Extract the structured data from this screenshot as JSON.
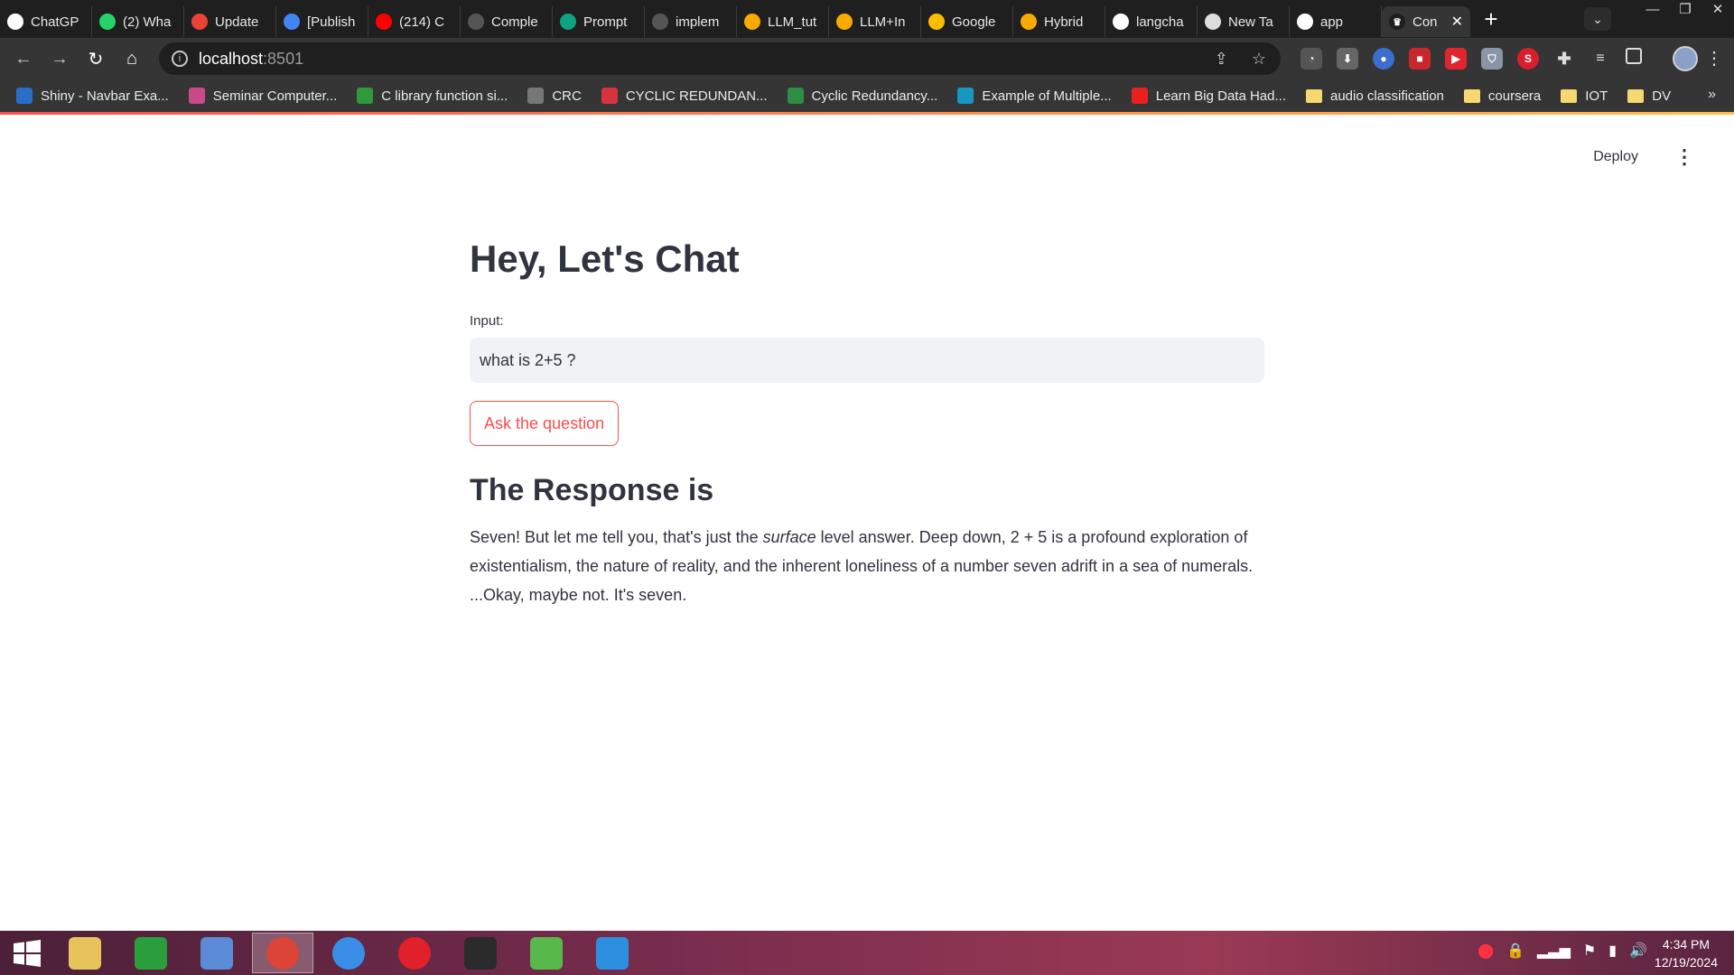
{
  "browser": {
    "tabs": [
      {
        "label": "ChatGP",
        "icon": "chatgpt-icon",
        "color": "#ffffff"
      },
      {
        "label": "(2) Wha",
        "icon": "whatsapp-icon",
        "color": "#25d366"
      },
      {
        "label": "Update",
        "icon": "gmail-icon",
        "color": "#ea4335"
      },
      {
        "label": "[Publish",
        "icon": "docs-icon",
        "color": "#4285f4"
      },
      {
        "label": "(214) C",
        "icon": "youtube-icon",
        "color": "#ff0000"
      },
      {
        "label": "Comple",
        "icon": "github-icon",
        "color": "#555555"
      },
      {
        "label": "Prompt",
        "icon": "chatgpt-icon",
        "color": "#10a37f"
      },
      {
        "label": "implem",
        "icon": "github-icon",
        "color": "#555555"
      },
      {
        "label": "LLM_tut",
        "icon": "colab-icon",
        "color": "#f9ab00"
      },
      {
        "label": "LLM+In",
        "icon": "colab-icon",
        "color": "#f9ab00"
      },
      {
        "label": "Google",
        "icon": "keep-icon",
        "color": "#fbbc04"
      },
      {
        "label": "Hybrid",
        "icon": "colab-icon",
        "color": "#f9ab00"
      },
      {
        "label": "langcha",
        "icon": "google-icon",
        "color": "#ffffff"
      },
      {
        "label": "New Ta",
        "icon": "chrome-icon",
        "color": "#dddddd"
      },
      {
        "label": "app",
        "icon": "streamlit-icon",
        "color": "#ffffff"
      }
    ],
    "active_tab": {
      "label": "Con",
      "icon": "streamlit-icon"
    },
    "address": {
      "host": "localhost",
      "port": ":8501"
    },
    "bookmarks": [
      {
        "label": "Shiny - Navbar Exa...",
        "icon": "shiny-icon",
        "color": "#2a6ec8"
      },
      {
        "label": "Seminar Computer...",
        "icon": "seminar-icon",
        "color": "#c84a8a"
      },
      {
        "label": "C library function si...",
        "icon": "c-library-icon",
        "color": "#2e9a3c"
      },
      {
        "label": "CRC",
        "icon": "globe-icon",
        "color": "#777777"
      },
      {
        "label": "CYCLIC REDUNDAN...",
        "icon": "scribd-icon",
        "color": "#d8323c"
      },
      {
        "label": "Cyclic Redundancy...",
        "icon": "gfg-icon",
        "color": "#2f8d46"
      },
      {
        "label": "Example of Multiple...",
        "icon": "salesforce-icon",
        "color": "#1798c1"
      },
      {
        "label": "Learn Big Data Had...",
        "icon": "vertex-icon",
        "color": "#e82020"
      },
      {
        "label": "audio classification",
        "icon": "folder-icon",
        "color": "#f5d870"
      },
      {
        "label": "coursera",
        "icon": "folder-icon",
        "color": "#f5d870"
      },
      {
        "label": "IOT",
        "icon": "folder-icon",
        "color": "#f5d870"
      },
      {
        "label": "DV",
        "icon": "folder-icon",
        "color": "#f5d870"
      }
    ]
  },
  "app": {
    "deploy_label": "Deploy",
    "title": "Hey, Let's Chat",
    "input_label": "Input:",
    "input_value": "what is 2+5 ?",
    "button_label": "Ask the question",
    "response_heading": "The Response is",
    "response_before": "Seven! But let me tell you, that's just the ",
    "response_emphasis": "surface",
    "response_after": " level answer. Deep down, 2 + 5 is a profound exploration of existentialism, the nature of reality, and the inherent loneliness of a number seven adrift in a sea of numerals. ...Okay, maybe not. It's seven.",
    "accent_color": "#ff4b4b"
  },
  "taskbar": {
    "apps": [
      {
        "name": "file-explorer-icon",
        "color": "#e8c25a"
      },
      {
        "name": "store-icon",
        "color": "#2a9d3c"
      },
      {
        "name": "network-icon",
        "color": "#5a8ad8"
      },
      {
        "name": "chrome-icon",
        "color": "#db4437"
      },
      {
        "name": "internet-explorer-icon",
        "color": "#3b8ee8"
      },
      {
        "name": "opera-icon",
        "color": "#e0202a"
      },
      {
        "name": "terminal-icon",
        "color": "#2b2b2b"
      },
      {
        "name": "sync-icon",
        "color": "#58b84a"
      },
      {
        "name": "vscode-icon",
        "color": "#2c8fe0"
      }
    ],
    "time": "4:34 PM",
    "date": "12/19/2024"
  }
}
